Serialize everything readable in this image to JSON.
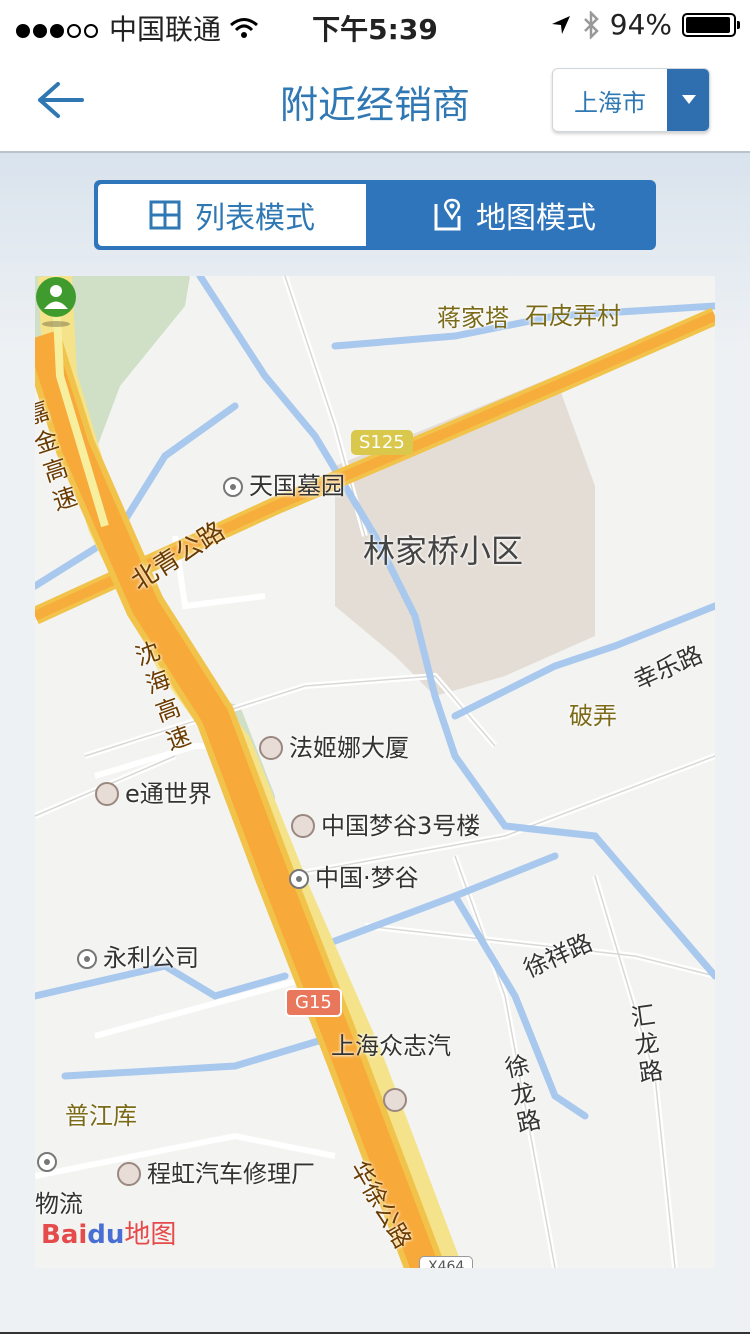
{
  "status_bar": {
    "carrier": "中国联通",
    "time": "下午5:39",
    "battery": "94%"
  },
  "nav": {
    "title": "附近经销商",
    "city": "上海市"
  },
  "modes": {
    "list_label": "列表模式",
    "map_label": "地图模式",
    "active": "map"
  },
  "map": {
    "labels": {
      "jiangjiata": "蒋家塔",
      "shipinongcun": "石皮弄村",
      "jiajin": "嘉金高速",
      "s125": "S125",
      "tianguo": "天国墓园",
      "beiqing": "北青公路",
      "linjiaqiao": "林家桥小区",
      "shenhai": "沈海高速",
      "xingle": "幸乐路",
      "ponong": "破弄",
      "faji": "法姬娜大厦",
      "etong": "e通世界",
      "mengu3": "中国梦谷3号楼",
      "mengu": "中国·梦谷",
      "yongli": "永利公司",
      "xuxiang": "徐祥路",
      "g15": "G15",
      "zhongzhi": "上海众志汽",
      "huilong": "汇龙路",
      "xulong": "徐龙路",
      "pujiangku": "普江库",
      "chenghong": "程虹汽车修理厂",
      "wuliu": "物流",
      "huaxu": "华徐公路",
      "x464": "X464"
    },
    "logo": {
      "bai": "Bai",
      "du": "du",
      "ditu": "地图"
    }
  }
}
